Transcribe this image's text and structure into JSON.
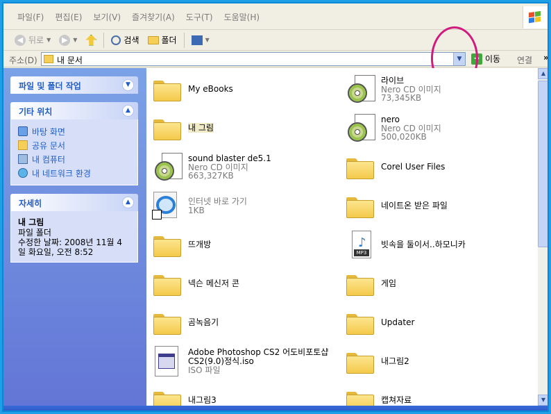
{
  "menu": [
    "파일(F)",
    "편집(E)",
    "보기(V)",
    "즐겨찾기(A)",
    "도구(T)",
    "도움말(H)"
  ],
  "toolbar": {
    "back": "뒤로",
    "search": "검색",
    "folders": "폴더"
  },
  "address": {
    "label": "주소(D)",
    "value": "내 문서",
    "go": "이동",
    "links": "연결",
    "more": "»"
  },
  "left": {
    "tasks_title": "파일 및 폴더 작업",
    "places_title": "기타 위치",
    "places": [
      "바탕 화면",
      "공유 문서",
      "내 컴퓨터",
      "내 네트워크 환경"
    ],
    "details_title": "자세히",
    "details_name": "내 그림",
    "details_type": "파일 폴더",
    "details_modified_1": "수정한 날짜: 2008년 11월 4",
    "details_modified_2": "일 화요일, 오전 8:52"
  },
  "files": [
    {
      "name": "My eBooks",
      "icon": "folder"
    },
    {
      "name": "라이브",
      "sub1": "Nero CD 이미지",
      "sub2": "73,345KB",
      "icon": "cd"
    },
    {
      "name": "내 그림",
      "icon": "folder-pictures"
    },
    {
      "name": "nero",
      "sub1": "Nero CD 이미지",
      "sub2": "500,020KB",
      "icon": "cd"
    },
    {
      "name": "sound blaster de5.1",
      "sub1": "Nero CD 이미지",
      "sub2": "663,327KB",
      "icon": "cd"
    },
    {
      "name": "Corel User Files",
      "icon": "folder"
    },
    {
      "name": "인터넷 바로 가기",
      "sub1": "1KB",
      "icon": "ie-shortcut"
    },
    {
      "name": "네이트온 받은 파일",
      "icon": "folder"
    },
    {
      "name": "뜨개방",
      "icon": "folder"
    },
    {
      "name": "빗속을 둘이서..하모니카",
      "icon": "mp3"
    },
    {
      "name": "넥슨 메신저 콘",
      "icon": "folder"
    },
    {
      "name": "게임",
      "icon": "folder"
    },
    {
      "name": "곰녹음기",
      "icon": "folder"
    },
    {
      "name": "Updater",
      "icon": "folder"
    },
    {
      "name": "Adobe Photoshop CS2 어도비포토샵",
      "name2": "CS2(9.0)정식.iso",
      "sub1": "ISO 파일",
      "icon": "iso"
    },
    {
      "name": "내그림2",
      "icon": "folder"
    },
    {
      "name": "내그림3",
      "icon": "folder"
    },
    {
      "name": "캡쳐자료",
      "icon": "folder"
    }
  ],
  "colors": {
    "accent": "#215dc6",
    "annotation": "#d11a7e"
  }
}
